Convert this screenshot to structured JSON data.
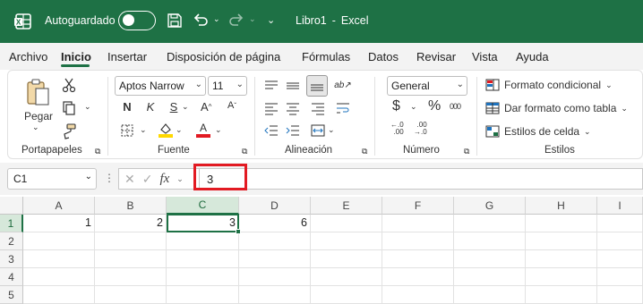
{
  "titlebar": {
    "autosave_label": "Autoguardado",
    "doc_title": "Libro1",
    "separator": "-",
    "app_name": "Excel"
  },
  "tabs": [
    "Archivo",
    "Inicio",
    "Insertar",
    "Disposición de página",
    "Fórmulas",
    "Datos",
    "Revisar",
    "Vista",
    "Ayuda"
  ],
  "ribbon": {
    "clipboard": {
      "paste_label": "Pegar",
      "group_label": "Portapapeles"
    },
    "font": {
      "font_name": "Aptos Narrow",
      "font_size": "11",
      "bold": "N",
      "italic": "K",
      "underline": "S",
      "group_label": "Fuente"
    },
    "alignment": {
      "group_label": "Alineación"
    },
    "number": {
      "format": "General",
      "currency": "$",
      "percent": "%",
      "group_label": "Número"
    },
    "styles": {
      "conditional_format": "Formato condicional",
      "format_as_table": "Dar formato como tabla",
      "cell_styles": "Estilos de celda",
      "group_label": "Estilos"
    }
  },
  "formula_bar": {
    "name_box": "C1",
    "fx": "fx",
    "content": "3"
  },
  "grid": {
    "columns": [
      "A",
      "B",
      "C",
      "D",
      "E",
      "F",
      "G",
      "H",
      "I"
    ],
    "rows": [
      "1",
      "2",
      "3",
      "4",
      "5"
    ],
    "cells": {
      "A1": "1",
      "B1": "2",
      "C1": "3",
      "D1": "6"
    }
  },
  "colors": {
    "accent": "#1e7145",
    "highlight_box": "#e21a22",
    "fill_yellow": "#ffd800",
    "font_red": "#e21a22"
  }
}
